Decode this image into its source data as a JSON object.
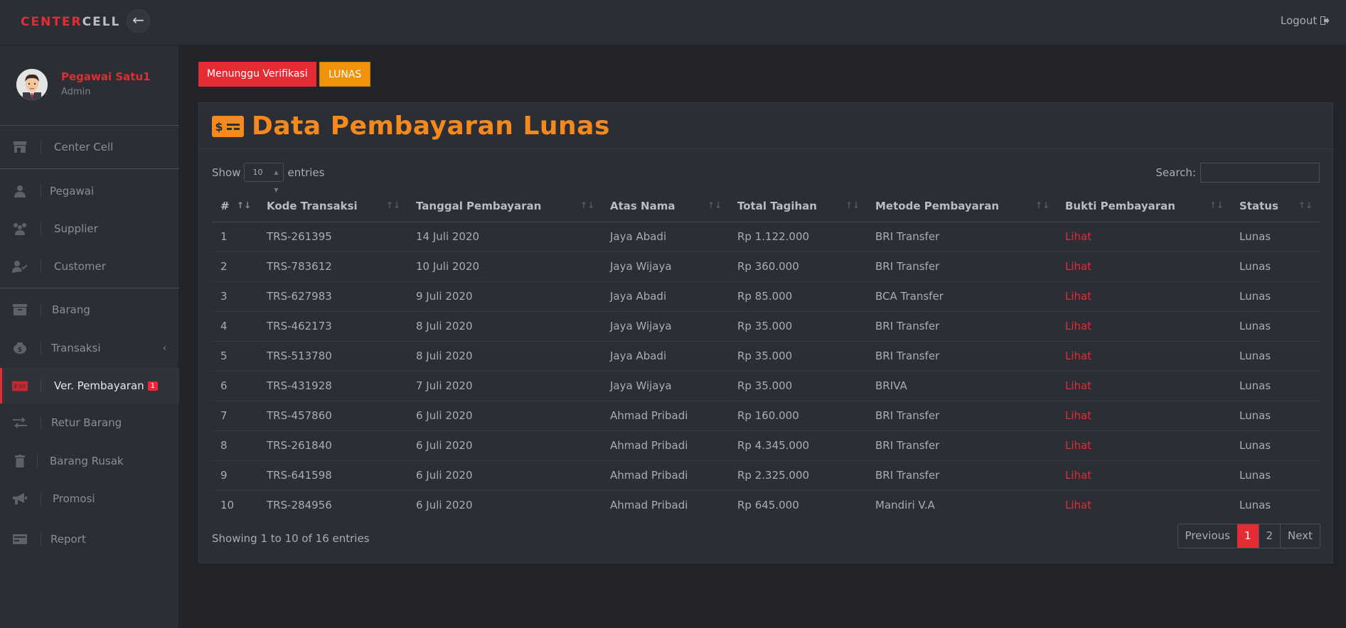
{
  "brand": {
    "part1": "CENTER",
    "part2": "CELL"
  },
  "topbar": {
    "back_icon": "arrow-left-icon",
    "logout_label": "Logout"
  },
  "user": {
    "name": "Pegawai Satu1",
    "role": "Admin"
  },
  "sidebar": {
    "items": [
      {
        "label": "Center Cell",
        "icon": "store-icon"
      },
      {
        "label": "Pegawai",
        "icon": "user-icon"
      },
      {
        "label": "Supplier",
        "icon": "users-icon"
      },
      {
        "label": "Customer",
        "icon": "user-check-icon"
      },
      {
        "label": "Barang",
        "icon": "archive-icon"
      },
      {
        "label": "Transaksi",
        "icon": "money-bag-icon"
      },
      {
        "label": "Ver. Pembayaran",
        "icon": "money-bill-icon",
        "badge": "1"
      },
      {
        "label": "Retur Barang",
        "icon": "exchange-icon"
      },
      {
        "label": "Barang Rusak",
        "icon": "trash-icon"
      },
      {
        "label": "Promosi",
        "icon": "bullhorn-icon"
      },
      {
        "label": "Report",
        "icon": "report-icon"
      }
    ]
  },
  "tabs": {
    "waiting": "Menunggu Verifikasi",
    "paid": "LUNAS"
  },
  "panel": {
    "title": "Data Pembayaran Lunas"
  },
  "controls": {
    "show_label": "Show",
    "entries_label": "entries",
    "length_value": "10",
    "search_label": "Search:"
  },
  "table": {
    "headers": [
      "#",
      "Kode Transaksi",
      "Tanggal Pembayaran",
      "Atas Nama",
      "Total Tagihan",
      "Metode Pembayaran",
      "Bukti Pembayaran",
      "Status"
    ],
    "rows": [
      [
        "1",
        "TRS-261395",
        "14 Juli 2020",
        "Jaya Abadi",
        "Rp 1.122.000",
        "BRI Transfer",
        "Lihat",
        "Lunas"
      ],
      [
        "2",
        "TRS-783612",
        "10 Juli 2020",
        "Jaya Wijaya",
        "Rp 360.000",
        "BRI Transfer",
        "Lihat",
        "Lunas"
      ],
      [
        "3",
        "TRS-627983",
        "9 Juli 2020",
        "Jaya Abadi",
        "Rp 85.000",
        "BCA Transfer",
        "Lihat",
        "Lunas"
      ],
      [
        "4",
        "TRS-462173",
        "8 Juli 2020",
        "Jaya Wijaya",
        "Rp 35.000",
        "BRI Transfer",
        "Lihat",
        "Lunas"
      ],
      [
        "5",
        "TRS-513780",
        "8 Juli 2020",
        "Jaya Abadi",
        "Rp 35.000",
        "BRI Transfer",
        "Lihat",
        "Lunas"
      ],
      [
        "6",
        "TRS-431928",
        "7 Juli 2020",
        "Jaya Wijaya",
        "Rp 35.000",
        "BRIVA",
        "Lihat",
        "Lunas"
      ],
      [
        "7",
        "TRS-457860",
        "6 Juli 2020",
        "Ahmad Pribadi",
        "Rp 160.000",
        "BRI Transfer",
        "Lihat",
        "Lunas"
      ],
      [
        "8",
        "TRS-261840",
        "6 Juli 2020",
        "Ahmad Pribadi",
        "Rp 4.345.000",
        "BRI Transfer",
        "Lihat",
        "Lunas"
      ],
      [
        "9",
        "TRS-641598",
        "6 Juli 2020",
        "Ahmad Pribadi",
        "Rp 2.325.000",
        "BRI Transfer",
        "Lihat",
        "Lunas"
      ],
      [
        "10",
        "TRS-284956",
        "6 Juli 2020",
        "Ahmad Pribadi",
        "Rp 645.000",
        "Mandiri V.A",
        "Lihat",
        "Lunas"
      ]
    ]
  },
  "footer": {
    "info": "Showing 1 to 10 of 16 entries",
    "pager": {
      "prev": "Previous",
      "p1": "1",
      "p2": "2",
      "next": "Next"
    }
  },
  "colors": {
    "accent_red": "#e52b34",
    "accent_orange": "#f5891e",
    "tab_orange": "#f0930a"
  }
}
